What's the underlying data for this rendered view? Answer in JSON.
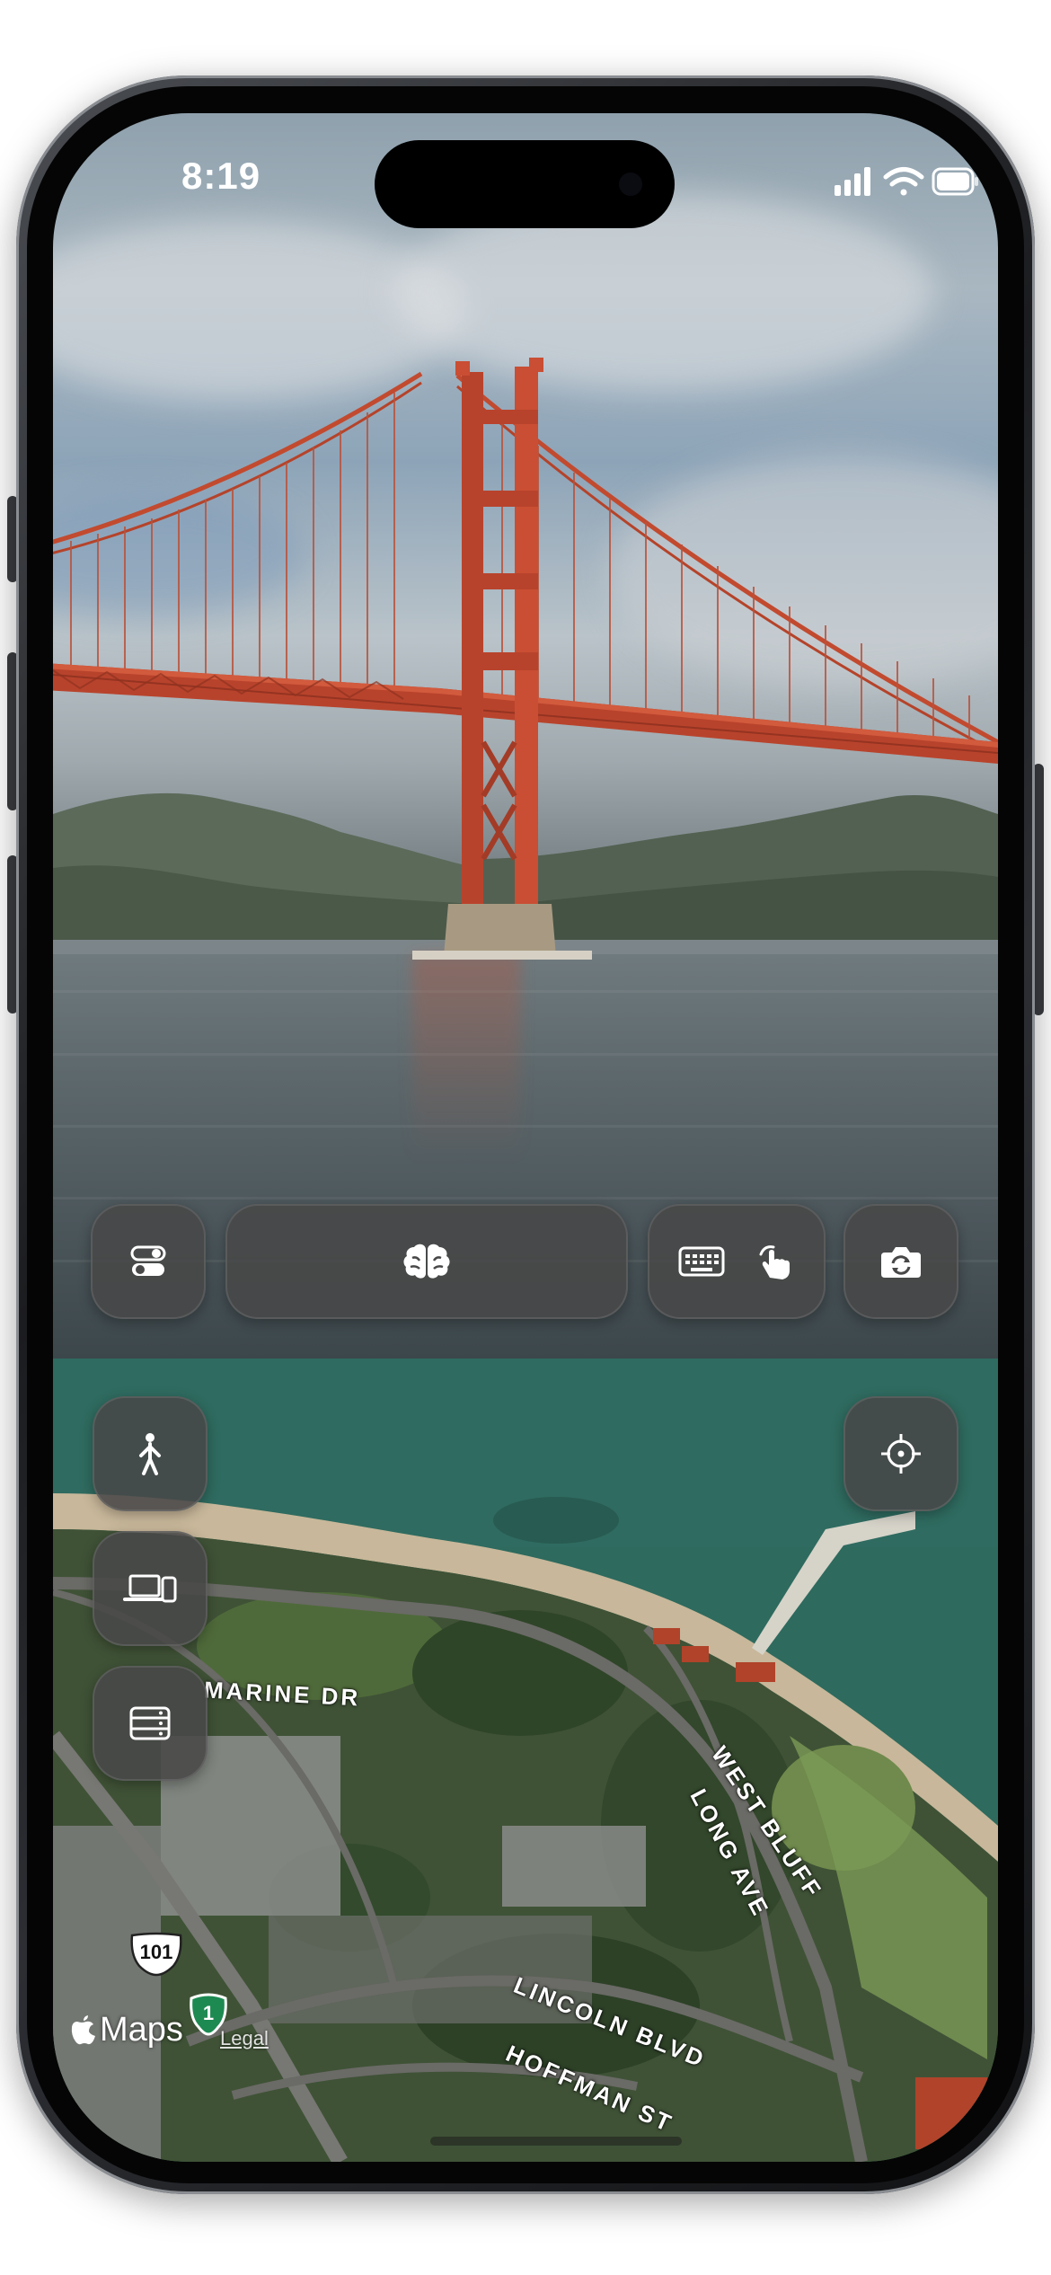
{
  "status_bar": {
    "time": "8:19"
  },
  "camera": {
    "controls": [
      {
        "name": "toggles-button",
        "icon": "toggle-switches-icon"
      },
      {
        "name": "brain-button",
        "icon": "brain-icon"
      },
      {
        "name": "input-mode-button",
        "icons": [
          "keyboard-icon",
          "tap-gesture-icon"
        ]
      },
      {
        "name": "flip-camera-button",
        "icon": "camera-rotate-icon"
      }
    ]
  },
  "map": {
    "side_buttons": [
      {
        "name": "walk-mode-button",
        "icon": "person-walking-icon"
      },
      {
        "name": "devices-button",
        "icon": "laptop-phone-icon"
      },
      {
        "name": "storage-button",
        "icon": "server-stack-icon"
      }
    ],
    "locate_button_icon": "crosshair-icon",
    "labels": {
      "marine_dr": "MARINE DR",
      "west_bluff": "WEST BLUFF",
      "long_ave": "LONG AVE",
      "lincoln_blvd": "LINCOLN BLVD",
      "hoffman_st": "HOFFMAN ST"
    },
    "shields": {
      "us_101": "101",
      "ca_1": "1"
    },
    "attribution": {
      "maps": "Maps",
      "legal": "Legal"
    }
  },
  "colors": {
    "bridge": "#c0452c",
    "button_bg": "#484848",
    "bay_water": "#2e6a5e"
  }
}
